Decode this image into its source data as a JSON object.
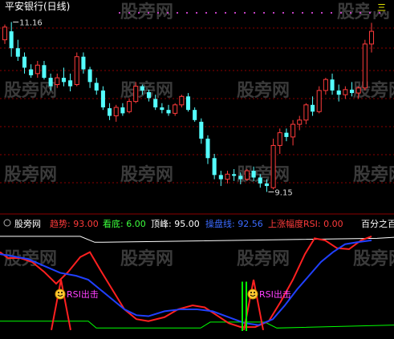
{
  "window": {
    "title": "平安银行(日线)",
    "top_right_glyph": "三"
  },
  "watermark": "股旁网",
  "price_panel": {
    "high_label": "11.16",
    "low_label": "9.15",
    "colors": {
      "up": "#ff3b3b",
      "down": "#54ffff",
      "grid": "#8b0000"
    }
  },
  "indicator_panel": {
    "name": "股旁网",
    "items": [
      {
        "key": "趋势",
        "value": "93.00",
        "color": "#ff3b3b"
      },
      {
        "key": "看底",
        "value": "6.00",
        "color": "#3cff3c"
      },
      {
        "key": "顶峰",
        "value": "95.00",
        "color": "#ffffff"
      },
      {
        "key": "操盘线",
        "value": "92.56",
        "color": "#3b6bff"
      },
      {
        "key": "上涨幅度RSI",
        "value": "0.00",
        "color": "#ff3b3b"
      }
    ],
    "right_label": "百分之百",
    "markers": [
      {
        "text": "RSI出击"
      },
      {
        "text": "RSI出击"
      }
    ],
    "colors": {
      "trend": "#ff2020",
      "operate": "#2040ff",
      "peak": "#ffffff",
      "bottom": "#00ff00",
      "signal": "#ff2020"
    }
  },
  "chart_data": {
    "type": "candlestick",
    "title": "平安银行(日线)",
    "annotations": [
      "11.16",
      "9.15"
    ],
    "ohlc": [
      [
        10.95,
        11.13,
        10.9,
        11.1
      ],
      [
        11.05,
        11.16,
        10.75,
        10.85
      ],
      [
        10.85,
        10.95,
        10.7,
        10.75
      ],
      [
        10.75,
        10.8,
        10.55,
        10.62
      ],
      [
        10.6,
        10.66,
        10.5,
        10.53
      ],
      [
        10.55,
        10.7,
        10.5,
        10.65
      ],
      [
        10.65,
        10.7,
        10.48,
        10.5
      ],
      [
        10.5,
        10.55,
        10.35,
        10.4
      ],
      [
        10.42,
        10.55,
        10.38,
        10.5
      ],
      [
        10.5,
        10.62,
        10.4,
        10.45
      ],
      [
        10.47,
        10.55,
        10.34,
        10.4
      ],
      [
        10.42,
        10.8,
        10.4,
        10.75
      ],
      [
        10.75,
        10.8,
        10.55,
        10.6
      ],
      [
        10.6,
        10.63,
        10.38,
        10.45
      ],
      [
        10.44,
        10.5,
        10.3,
        10.35
      ],
      [
        10.35,
        10.4,
        10.12,
        10.15
      ],
      [
        10.14,
        10.2,
        10.0,
        10.05
      ],
      [
        10.05,
        10.18,
        9.98,
        10.15
      ],
      [
        10.15,
        10.2,
        10.05,
        10.08
      ],
      [
        10.1,
        10.25,
        10.08,
        10.22
      ],
      [
        10.22,
        10.45,
        10.2,
        10.4
      ],
      [
        10.4,
        10.42,
        10.3,
        10.35
      ],
      [
        10.33,
        10.36,
        10.22,
        10.26
      ],
      [
        10.25,
        10.3,
        10.12,
        10.15
      ],
      [
        10.15,
        10.2,
        10.08,
        10.12
      ],
      [
        10.12,
        10.18,
        10.05,
        10.08
      ],
      [
        10.08,
        10.2,
        10.05,
        10.18
      ],
      [
        10.18,
        10.3,
        10.15,
        10.28
      ],
      [
        10.28,
        10.32,
        10.1,
        10.12
      ],
      [
        10.12,
        10.15,
        9.98,
        10.0
      ],
      [
        9.98,
        10.02,
        9.72,
        9.78
      ],
      [
        9.78,
        9.82,
        9.48,
        9.55
      ],
      [
        9.55,
        9.6,
        9.3,
        9.35
      ],
      [
        9.35,
        9.4,
        9.22,
        9.3
      ],
      [
        9.3,
        9.4,
        9.25,
        9.36
      ],
      [
        9.36,
        9.42,
        9.28,
        9.34
      ],
      [
        9.34,
        9.38,
        9.24,
        9.3
      ],
      [
        9.3,
        9.42,
        9.28,
        9.4
      ],
      [
        9.4,
        9.45,
        9.28,
        9.32
      ],
      [
        9.32,
        9.36,
        9.2,
        9.25
      ],
      [
        9.25,
        9.3,
        9.15,
        9.22
      ],
      [
        9.2,
        9.78,
        9.18,
        9.7
      ],
      [
        9.7,
        9.9,
        9.6,
        9.85
      ],
      [
        9.85,
        9.9,
        9.75,
        9.8
      ],
      [
        9.8,
        10.0,
        9.7,
        9.95
      ],
      [
        9.95,
        10.05,
        9.88,
        10.0
      ],
      [
        10.0,
        10.2,
        9.95,
        10.18
      ],
      [
        10.18,
        10.28,
        10.05,
        10.1
      ],
      [
        10.1,
        10.4,
        10.08,
        10.35
      ],
      [
        10.35,
        10.5,
        10.3,
        10.48
      ],
      [
        10.48,
        10.55,
        10.3,
        10.35
      ],
      [
        10.35,
        10.42,
        10.22,
        10.3
      ],
      [
        10.3,
        10.4,
        10.25,
        10.36
      ],
      [
        10.36,
        10.45,
        10.28,
        10.32
      ],
      [
        10.32,
        10.4,
        10.25,
        10.38
      ],
      [
        10.38,
        10.95,
        10.35,
        10.9
      ],
      [
        10.9,
        11.15,
        10.8,
        11.05
      ]
    ]
  }
}
